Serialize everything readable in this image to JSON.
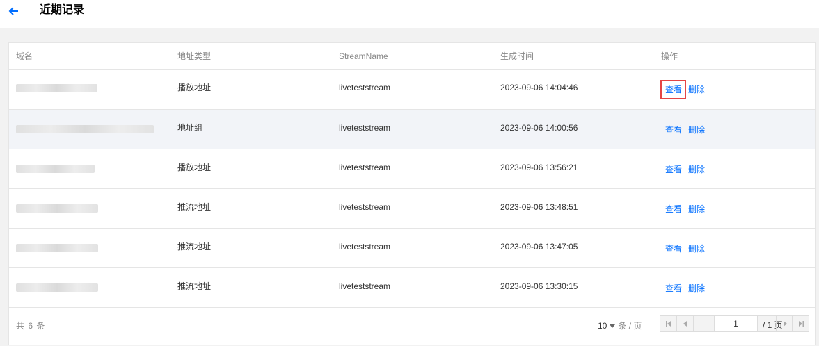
{
  "header": {
    "title": "近期记录"
  },
  "table": {
    "columns": {
      "domain": "域名",
      "type": "地址类型",
      "stream": "StreamName",
      "time": "生成时间",
      "action": "操作"
    },
    "rows": [
      {
        "type": "播放地址",
        "stream": "liveteststream",
        "time": "2023-09-06 14:04:46",
        "view": "查看",
        "delete": "删除"
      },
      {
        "type": "地址组",
        "stream": "liveteststream",
        "time": "2023-09-06 14:00:56",
        "view": "查看",
        "delete": "删除"
      },
      {
        "type": "播放地址",
        "stream": "liveteststream",
        "time": "2023-09-06 13:56:21",
        "view": "查看",
        "delete": "删除"
      },
      {
        "type": "推流地址",
        "stream": "liveteststream",
        "time": "2023-09-06 13:48:51",
        "view": "查看",
        "delete": "删除"
      },
      {
        "type": "推流地址",
        "stream": "liveteststream",
        "time": "2023-09-06 13:47:05",
        "view": "查看",
        "delete": "删除"
      },
      {
        "type": "推流地址",
        "stream": "liveteststream",
        "time": "2023-09-06 13:30:15",
        "view": "查看",
        "delete": "删除"
      }
    ]
  },
  "pagination": {
    "total": "共 6 条",
    "page_size": "10",
    "page_size_unit": "条 / 页",
    "current_page": "1",
    "total_pages": "/ 1 页"
  },
  "colors": {
    "accent": "#006eff",
    "highlight_box": "#e54545",
    "hover_row": "#f2f4f8"
  },
  "icons": [
    "back-arrow-icon",
    "caret-down-icon",
    "first-page-icon",
    "prev-page-icon",
    "next-page-icon",
    "last-page-icon"
  ]
}
